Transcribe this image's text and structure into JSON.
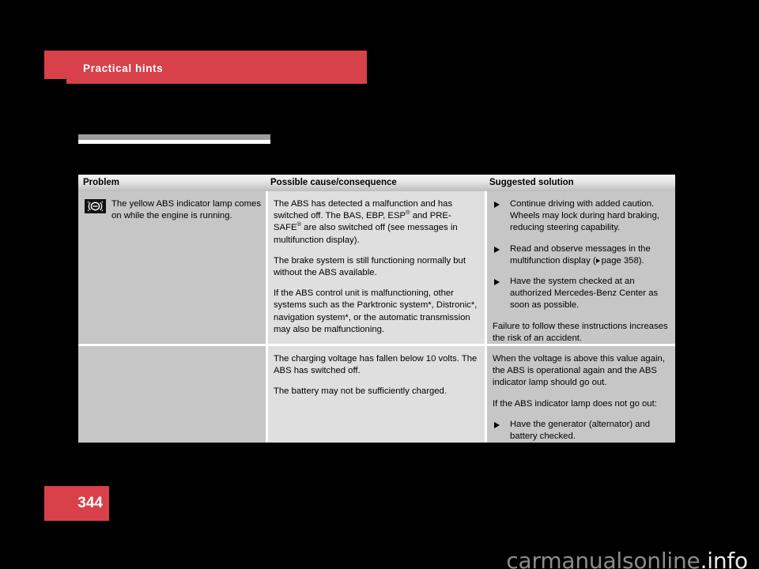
{
  "chapter": {
    "title": "Practical hints"
  },
  "page": {
    "number": "344"
  },
  "watermark": {
    "site": "carmanualsonline",
    "tld": ".info"
  },
  "colors": {
    "brand_red": "#d8404a",
    "header_gradient_top": "#f3f3f3",
    "header_gradient_bottom": "#bdbdbd",
    "col1_bg": "#c6c6c6",
    "col2_bg": "#dfdfdf",
    "col3_bg": "#c6c6c6",
    "rule_gray": "#9d9d9d",
    "icon_bg": "#111111"
  },
  "table": {
    "headers": {
      "problem": "Problem",
      "cause": "Possible cause/consequence",
      "solution": "Suggested solution"
    },
    "rows": [
      {
        "problem": {
          "icon": "abs-warning-lamp-icon",
          "text": "The yellow ABS indicator lamp comes on while the engine is running."
        },
        "cause_paragraphs": [
          "The ABS has detected a malfunction and has switched off. The BAS, EBP, ESP® and PRE-SAFE® are also switched off (see messages in multifunction display).",
          "The brake system is still functioning normally but without the ABS available.",
          "If the ABS control unit is malfunctioning, other systems such as the Parktronic system*, Distronic*, navigation system*, or the automatic transmission may also be malfunctioning."
        ],
        "solution_bullets": [
          "Continue driving with added caution. Wheels may lock during hard braking, reducing steering capability.",
          "Read and observe messages in the multifunction display (▷ page 358).",
          "Have the system checked at an authorized Mercedes-Benz Center as soon as possible."
        ],
        "solution_note": "Failure to follow these instructions increases the risk of an accident."
      },
      {
        "cause_paragraphs": [
          "The charging voltage has fallen below 10 volts. The ABS has switched off.",
          "The battery may not be sufficiently charged."
        ],
        "solution_intro": "When the voltage is above this value again, the ABS is operational again and the ABS indicator lamp should go out.",
        "solution_condition": "If the ABS indicator lamp does not go out:",
        "solution_bullets": [
          "Have the generator (alternator) and battery checked."
        ]
      }
    ]
  }
}
